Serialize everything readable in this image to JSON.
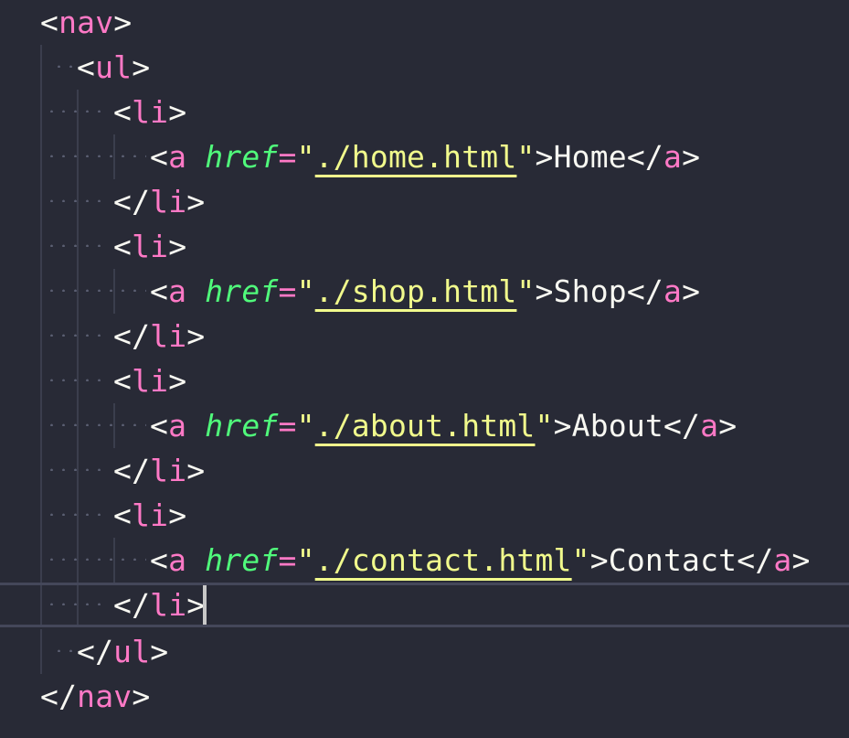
{
  "editor": {
    "lines": [
      {
        "open": "<",
        "tag": "nav",
        "close": ">"
      },
      {
        "open": "<",
        "tag": "ul",
        "close": ">"
      },
      {
        "open": "<",
        "tag": "li",
        "close": ">"
      },
      {
        "lt": "<",
        "tag": "a",
        "attr": "href",
        "eq": "=",
        "q1": "\"",
        "value": "./home.html",
        "q2": "\"",
        "gt": ">",
        "text": "Home",
        "close_open": "</",
        "close_tag": "a",
        "close_gt": ">"
      },
      {
        "open": "</",
        "tag": "li",
        "close": ">"
      },
      {
        "open": "<",
        "tag": "li",
        "close": ">"
      },
      {
        "lt": "<",
        "tag": "a",
        "attr": "href",
        "eq": "=",
        "q1": "\"",
        "value": "./shop.html",
        "q2": "\"",
        "gt": ">",
        "text": "Shop",
        "close_open": "</",
        "close_tag": "a",
        "close_gt": ">"
      },
      {
        "open": "</",
        "tag": "li",
        "close": ">"
      },
      {
        "open": "<",
        "tag": "li",
        "close": ">"
      },
      {
        "lt": "<",
        "tag": "a",
        "attr": "href",
        "eq": "=",
        "q1": "\"",
        "value": "./about.html",
        "q2": "\"",
        "gt": ">",
        "text": "About",
        "close_open": "</",
        "close_tag": "a",
        "close_gt": ">"
      },
      {
        "open": "</",
        "tag": "li",
        "close": ">"
      },
      {
        "open": "<",
        "tag": "li",
        "close": ">"
      },
      {
        "lt": "<",
        "tag": "a",
        "attr": "href",
        "eq": "=",
        "q1": "\"",
        "value": "./contact.html",
        "q2": "\"",
        "gt": ">",
        "text": "Contact",
        "close_open": "</",
        "close_tag": "a",
        "close_gt": ">"
      },
      {
        "open": "</",
        "tag": "li",
        "close": ">"
      },
      {
        "open": "</",
        "tag": "ul",
        "close": ">"
      },
      {
        "open": "</",
        "tag": "nav",
        "close": ">"
      }
    ],
    "colors": {
      "background": "#282a36",
      "tag": "#ff79c6",
      "attribute": "#50fa7b",
      "string": "#f1fa8c",
      "text": "#f8f8f2",
      "current_line_border": "#44475a",
      "cursor": "#c8c8c8"
    }
  }
}
